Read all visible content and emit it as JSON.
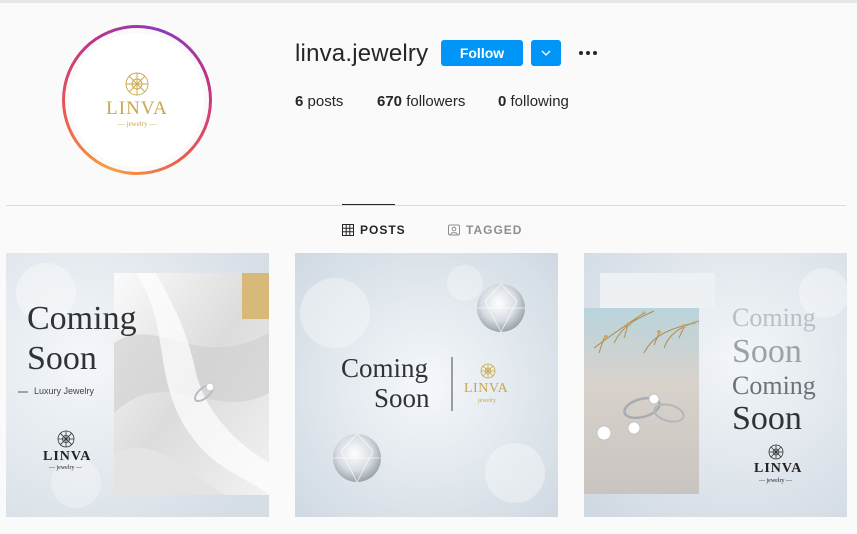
{
  "profile": {
    "username": "linva.jewelry",
    "follow_label": "Follow",
    "avatar_logo": {
      "word": "LINVA",
      "sub": "— jewelry —"
    }
  },
  "stats": {
    "posts_count": "6",
    "posts_label": "posts",
    "followers_count": "670",
    "followers_label": "followers",
    "following_count": "0",
    "following_label": "following"
  },
  "tabs": [
    {
      "label": "POSTS",
      "active": true
    },
    {
      "label": "TAGGED",
      "active": false
    }
  ],
  "posts": [
    {
      "title_line1": "Coming",
      "title_line2": "Soon",
      "tagline": "Luxury Jewelry",
      "brand": "LINVA",
      "brand_sub": "— jewelry —"
    },
    {
      "title_line1": "Coming",
      "title_line2": "Soon",
      "brand": "LINVA",
      "brand_sub": "jewelry"
    },
    {
      "line1": "Coming",
      "line2": "Soon",
      "line3": "Coming",
      "line4": "Soon",
      "brand": "LINVA",
      "brand_sub": "— jewelry —"
    }
  ],
  "colors": {
    "accent": "#0095f6",
    "gold": "#c9a84b",
    "text": "#262626",
    "muted": "#8e8e8e"
  },
  "icons": [
    "chevron-down-icon",
    "more-options-icon",
    "grid-icon",
    "tagged-icon",
    "diamond-icon"
  ]
}
